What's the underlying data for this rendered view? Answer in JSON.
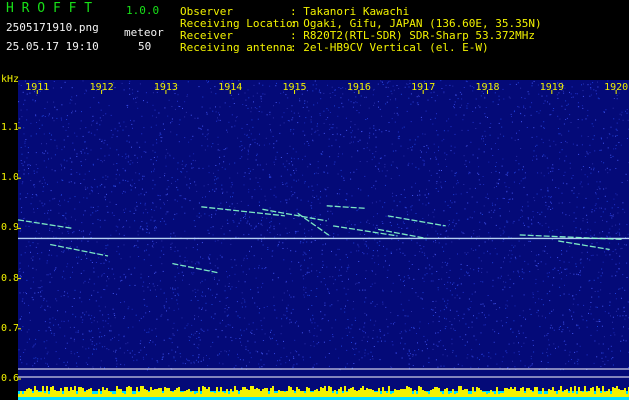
{
  "header": {
    "app_name": "H R O F F T",
    "version": "1.0.0",
    "filename": "2505171910.png",
    "category_label": "meteor",
    "datetime": "25.05.17 19:10",
    "count": "50",
    "info_labels": [
      "Observer",
      "Receiving Location",
      "Receiver",
      "Receiving antenna"
    ],
    "info_values": [
      ": Takanori Kawachi",
      ": Ogaki, Gifu, JAPAN (136.60E, 35.35N)",
      ": R820T2(RTL-SDR) SDR-Sharp 53.372MHz",
      ": 2el-HB9CV Vertical (el. E-W)"
    ]
  },
  "chart_data": {
    "type": "heatmap",
    "ylabel": "kHz",
    "x_ticks": [
      "1911",
      "1912",
      "1913",
      "1914",
      "1915",
      "1916",
      "1917",
      "1918",
      "1919",
      "1920"
    ],
    "y_ticks": [
      "1.1",
      "1.0",
      "0.9",
      "0.8",
      "0.7",
      "0.6"
    ],
    "yaxis_values": [
      1.1,
      1.0,
      0.9,
      0.8,
      0.7,
      0.6
    ],
    "ylim": [
      0.6,
      1.2
    ],
    "xlim": [
      1910.7,
      1920.2
    ],
    "carrier_khz": 0.88,
    "meteor_traces": [
      {
        "x0": 1910.7,
        "y0": 0.917,
        "x1": 1911.55,
        "y1": 0.9
      },
      {
        "x0": 1913.55,
        "y0": 0.943,
        "x1": 1914.85,
        "y1": 0.925
      },
      {
        "x0": 1914.5,
        "y0": 0.938,
        "x1": 1915.5,
        "y1": 0.915
      },
      {
        "x0": 1915.05,
        "y0": 0.93,
        "x1": 1915.55,
        "y1": 0.885
      },
      {
        "x0": 1915.6,
        "y0": 0.905,
        "x1": 1916.6,
        "y1": 0.885
      },
      {
        "x0": 1916.45,
        "y0": 0.925,
        "x1": 1917.35,
        "y1": 0.905
      },
      {
        "x0": 1916.3,
        "y0": 0.898,
        "x1": 1917.05,
        "y1": 0.88
      },
      {
        "x0": 1915.5,
        "y0": 0.945,
        "x1": 1916.1,
        "y1": 0.94
      },
      {
        "x0": 1911.2,
        "y0": 0.868,
        "x1": 1912.1,
        "y1": 0.845
      },
      {
        "x0": 1913.1,
        "y0": 0.83,
        "x1": 1913.8,
        "y1": 0.812
      },
      {
        "x0": 1918.5,
        "y0": 0.887,
        "x1": 1920.1,
        "y1": 0.878
      },
      {
        "x0": 1919.1,
        "y0": 0.875,
        "x1": 1919.9,
        "y1": 0.858
      }
    ],
    "colors": {
      "background": "#040a78",
      "noise": "#2233cc",
      "carrier": "#c8e6ff",
      "trace": "#88ffcc",
      "activity": "#f2f200",
      "baseline": "#00e0ff"
    }
  }
}
